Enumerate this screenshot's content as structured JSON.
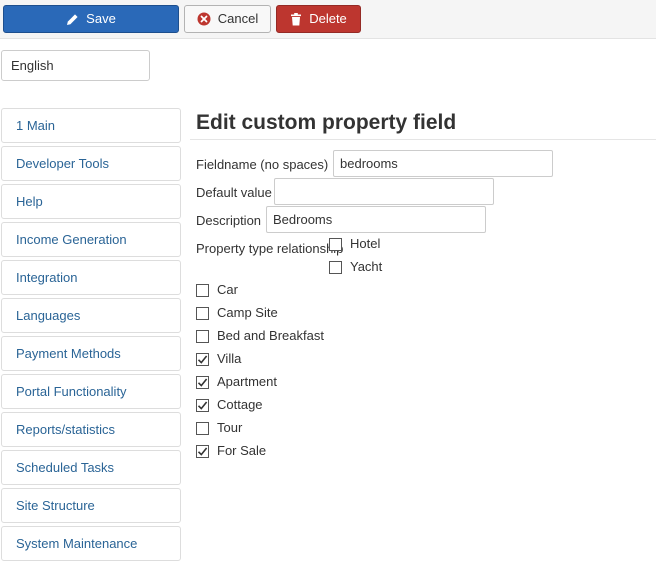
{
  "toolbar": {
    "save_label": "Save",
    "cancel_label": "Cancel",
    "delete_label": "Delete"
  },
  "language": {
    "selected": "English"
  },
  "sidebar": {
    "items": [
      {
        "label": "1 Main"
      },
      {
        "label": "Developer Tools"
      },
      {
        "label": "Help"
      },
      {
        "label": "Income Generation"
      },
      {
        "label": "Integration"
      },
      {
        "label": "Languages"
      },
      {
        "label": "Payment Methods"
      },
      {
        "label": "Portal Functionality"
      },
      {
        "label": "Reports/statistics"
      },
      {
        "label": "Scheduled Tasks"
      },
      {
        "label": "Site Structure"
      },
      {
        "label": "System Maintenance"
      }
    ]
  },
  "form": {
    "title": "Edit custom property field",
    "fieldname": {
      "label": "Fieldname (no spaces)",
      "value": "bedrooms"
    },
    "default_value": {
      "label": "Default value",
      "value": ""
    },
    "description": {
      "label": "Description",
      "value": "Bedrooms"
    },
    "relationship_label": "Property type relationship",
    "property_types": [
      {
        "label": "Hotel",
        "checked": false
      },
      {
        "label": "Yacht",
        "checked": false
      },
      {
        "label": "Car",
        "checked": false
      },
      {
        "label": "Camp Site",
        "checked": false
      },
      {
        "label": "Bed and Breakfast",
        "checked": false
      },
      {
        "label": "Villa",
        "checked": true
      },
      {
        "label": "Apartment",
        "checked": true
      },
      {
        "label": "Cottage",
        "checked": true
      },
      {
        "label": "Tour",
        "checked": false
      },
      {
        "label": "For Sale",
        "checked": true
      }
    ]
  }
}
